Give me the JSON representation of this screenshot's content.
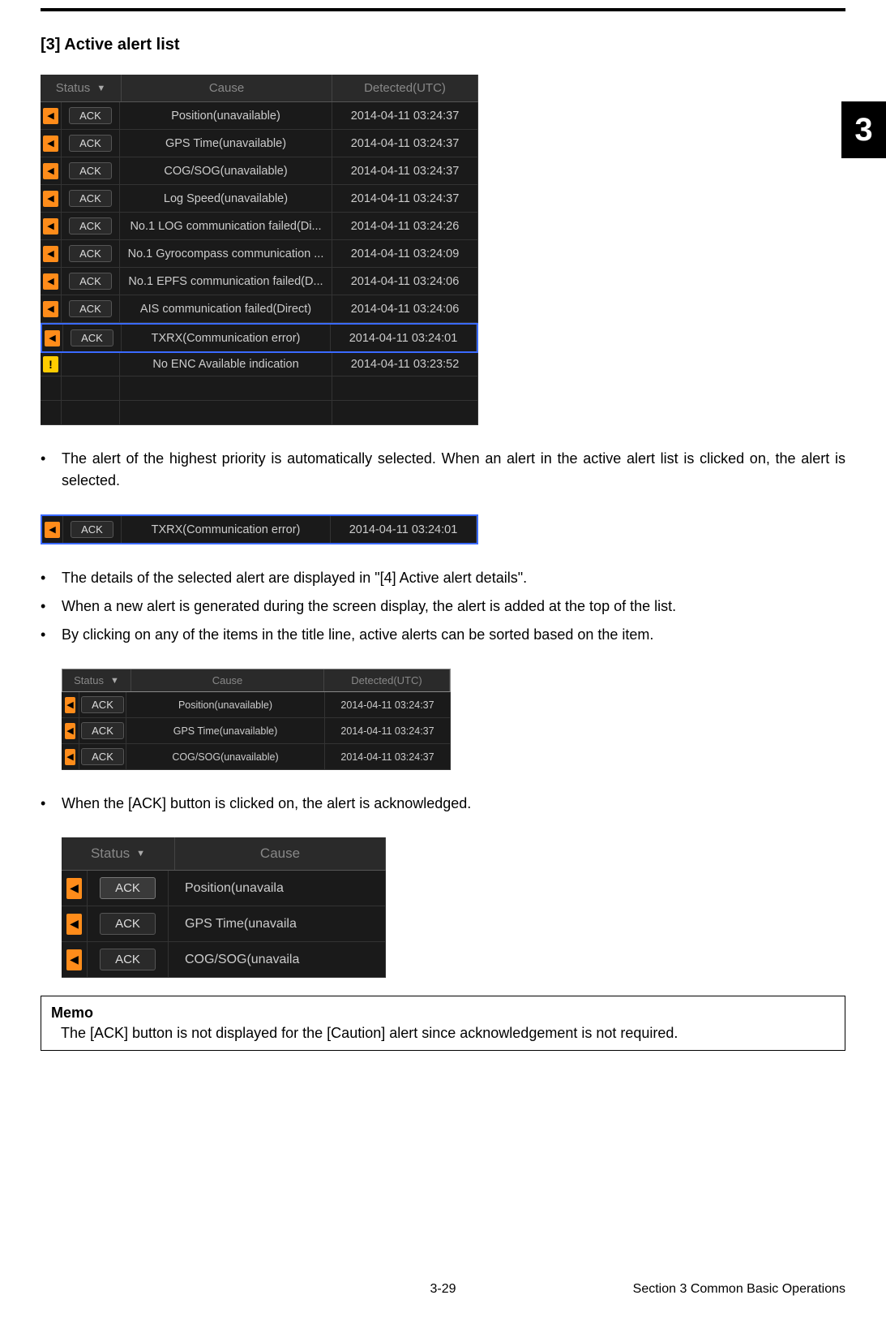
{
  "side_tab": "3",
  "heading": "[3]  Active alert list",
  "columns": {
    "status": "Status",
    "cause": "Cause",
    "detected": "Detected(UTC)"
  },
  "main_table": {
    "rows": [
      {
        "icon": "warn",
        "ack": "ACK",
        "cause": "Position(unavailable)",
        "detected": "2014-04-11 03:24:37",
        "selected": false
      },
      {
        "icon": "warn",
        "ack": "ACK",
        "cause": "GPS Time(unavailable)",
        "detected": "2014-04-11 03:24:37",
        "selected": false
      },
      {
        "icon": "warn",
        "ack": "ACK",
        "cause": "COG/SOG(unavailable)",
        "detected": "2014-04-11 03:24:37",
        "selected": false
      },
      {
        "icon": "warn",
        "ack": "ACK",
        "cause": "Log Speed(unavailable)",
        "detected": "2014-04-11 03:24:37",
        "selected": false
      },
      {
        "icon": "warn",
        "ack": "ACK",
        "cause": "No.1 LOG communication failed(Di...",
        "detected": "2014-04-11 03:24:26",
        "selected": false
      },
      {
        "icon": "warn",
        "ack": "ACK",
        "cause": "No.1 Gyrocompass communication ...",
        "detected": "2014-04-11 03:24:09",
        "selected": false
      },
      {
        "icon": "warn",
        "ack": "ACK",
        "cause": "No.1 EPFS communication failed(D...",
        "detected": "2014-04-11 03:24:06",
        "selected": false
      },
      {
        "icon": "warn",
        "ack": "ACK",
        "cause": "AIS communication failed(Direct)",
        "detected": "2014-04-11 03:24:06",
        "selected": false
      },
      {
        "icon": "warn",
        "ack": "ACK",
        "cause": "TXRX(Communication error)",
        "detected": "2014-04-11 03:24:01",
        "selected": true
      },
      {
        "icon": "caution",
        "ack": "",
        "cause": "No ENC Available indication",
        "detected": "2014-04-11 03:23:52",
        "selected": false
      }
    ]
  },
  "bullets": {
    "b1": "The alert of the highest priority is automatically selected. When an alert in the active alert list is clicked on, the alert is selected.",
    "b2": "The details of the selected alert are displayed in \"[4] Active alert details\".",
    "b3": "When a new alert is generated during the screen display, the alert is added at the top of the list.",
    "b4": "By clicking on any of the items in the title line, active alerts can be sorted based on the item.",
    "b5": "When the [ACK] button is clicked on, the alert is acknowledged."
  },
  "single_row": {
    "ack": "ACK",
    "cause": "TXRX(Communication error)",
    "detected": "2014-04-11 03:24:01"
  },
  "small_table": {
    "rows": [
      {
        "ack": "ACK",
        "cause": "Position(unavailable)",
        "detected": "2014-04-11 03:24:37"
      },
      {
        "ack": "ACK",
        "cause": "GPS Time(unavailable)",
        "detected": "2014-04-11 03:24:37"
      },
      {
        "ack": "ACK",
        "cause": "COG/SOG(unavailable)",
        "detected": "2014-04-11 03:24:37"
      }
    ]
  },
  "ack_table": {
    "rows": [
      {
        "ack": "ACK",
        "cause": "Position(unavaila",
        "highlight": true
      },
      {
        "ack": "ACK",
        "cause": "GPS Time(unavaila",
        "highlight": false
      },
      {
        "ack": "ACK",
        "cause": "COG/SOG(unavaila",
        "highlight": false
      }
    ]
  },
  "memo": {
    "title": "Memo",
    "text": "The [ACK] button is not displayed for the [Caution] alert since acknowledgement is not required."
  },
  "footer": {
    "page": "3-29",
    "section": "Section 3    Common Basic Operations"
  }
}
